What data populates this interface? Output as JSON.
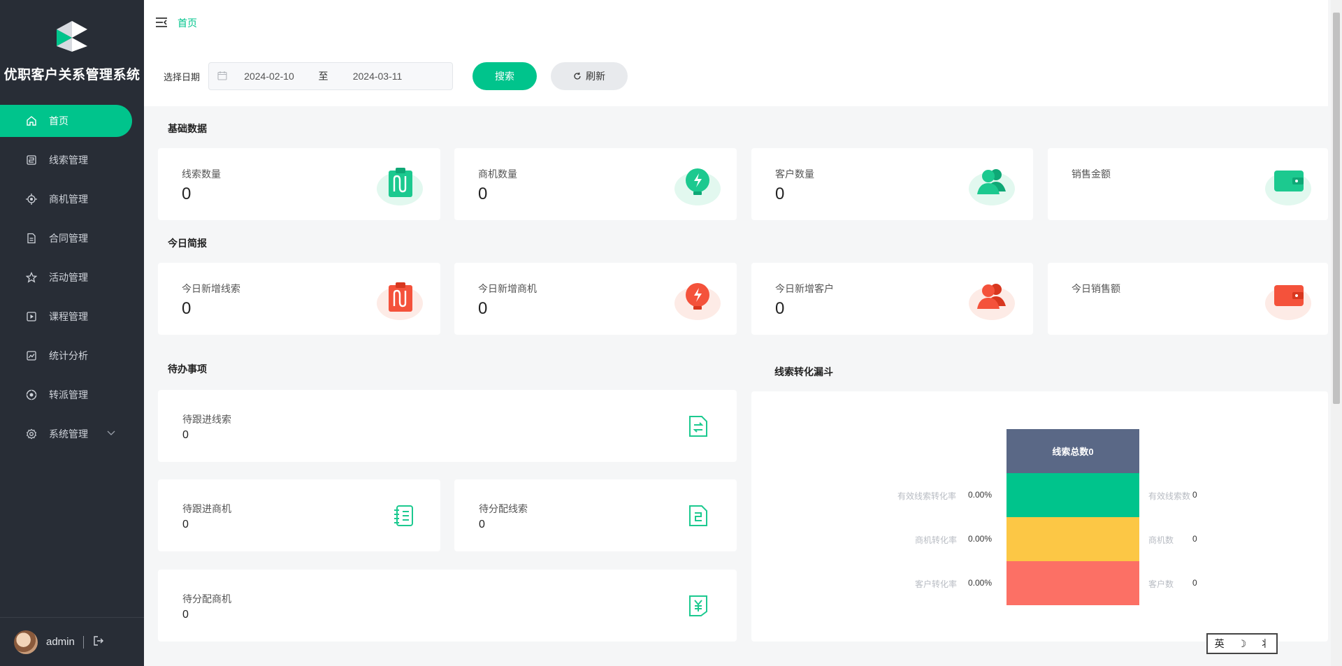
{
  "app": {
    "name": "优职客户关系管理系统"
  },
  "sidebar": {
    "items": [
      {
        "label": "首页",
        "icon": "home-icon",
        "active": true
      },
      {
        "label": "线索管理",
        "icon": "clue-icon"
      },
      {
        "label": "商机管理",
        "icon": "opportunity-icon"
      },
      {
        "label": "合同管理",
        "icon": "contract-icon"
      },
      {
        "label": "活动管理",
        "icon": "star-icon"
      },
      {
        "label": "课程管理",
        "icon": "course-icon"
      },
      {
        "label": "统计分析",
        "icon": "chart-icon"
      },
      {
        "label": "转派管理",
        "icon": "transfer-icon"
      },
      {
        "label": "系统管理",
        "icon": "gear-icon",
        "expandable": true
      }
    ],
    "user": {
      "name": "admin"
    }
  },
  "header": {
    "breadcrumb": "首页"
  },
  "filter": {
    "label": "选择日期",
    "start_date": "2024-02-10",
    "separator": "至",
    "end_date": "2024-03-11",
    "search_label": "搜索",
    "refresh_label": "刷新"
  },
  "basic": {
    "title": "基础数据",
    "cards": [
      {
        "label": "线索数量",
        "value": "0"
      },
      {
        "label": "商机数量",
        "value": "0"
      },
      {
        "label": "客户数量",
        "value": "0"
      },
      {
        "label": "销售金额",
        "value": ""
      }
    ]
  },
  "today": {
    "title": "今日简报",
    "cards": [
      {
        "label": "今日新增线索",
        "value": "0"
      },
      {
        "label": "今日新增商机",
        "value": "0"
      },
      {
        "label": "今日新增客户",
        "value": "0"
      },
      {
        "label": "今日销售额",
        "value": ""
      }
    ]
  },
  "todo": {
    "title": "待办事项",
    "cards": [
      {
        "label": "待跟进线索",
        "value": "0"
      },
      {
        "label": "待跟进商机",
        "value": "0"
      },
      {
        "label": "待分配线索",
        "value": "0"
      },
      {
        "label": "待分配商机",
        "value": "0"
      }
    ]
  },
  "funnel": {
    "title": "线索转化漏斗",
    "head": "线索总数0",
    "rows": [
      {
        "left_label": "有效线索转化率",
        "left_value": "0.00%",
        "right_label": "有效线索数",
        "right_value": "0"
      },
      {
        "left_label": "商机转化率",
        "left_value": "0.00%",
        "right_label": "商机数",
        "right_value": "0"
      },
      {
        "left_label": "客户转化率",
        "left_value": "0.00%",
        "right_label": "客户数",
        "right_value": "0"
      }
    ]
  },
  "ime": {
    "items": [
      "英",
      "☽",
      "⺦"
    ]
  },
  "colors": {
    "accent": "#00c48c",
    "sidebar": "#282d36",
    "funnel_head": "#5a6886",
    "funnel_1": "#00c48c",
    "funnel_2": "#fcc745",
    "funnel_3": "#fc7065",
    "red": "#f4523b"
  }
}
